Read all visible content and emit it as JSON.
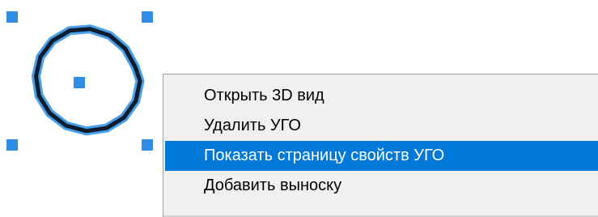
{
  "colors": {
    "selection_blue": "#2f8de4",
    "circle_stroke": "#0d1c2e",
    "circle_halo": "#4a9fe6",
    "menu_background": "#f0f0f0",
    "menu_highlight": "#0078d7",
    "menu_highlight_text": "#ffffff"
  },
  "symbol": {
    "icon": "circle-symbol-selected-with-grips"
  },
  "context_menu": {
    "items": [
      {
        "label": "Открыть 3D вид",
        "highlighted": false
      },
      {
        "label": "Удалить УГО",
        "highlighted": false
      },
      {
        "label": "Показать страницу свойств УГО",
        "highlighted": true
      },
      {
        "label": "Добавить выноску",
        "highlighted": false
      }
    ]
  }
}
